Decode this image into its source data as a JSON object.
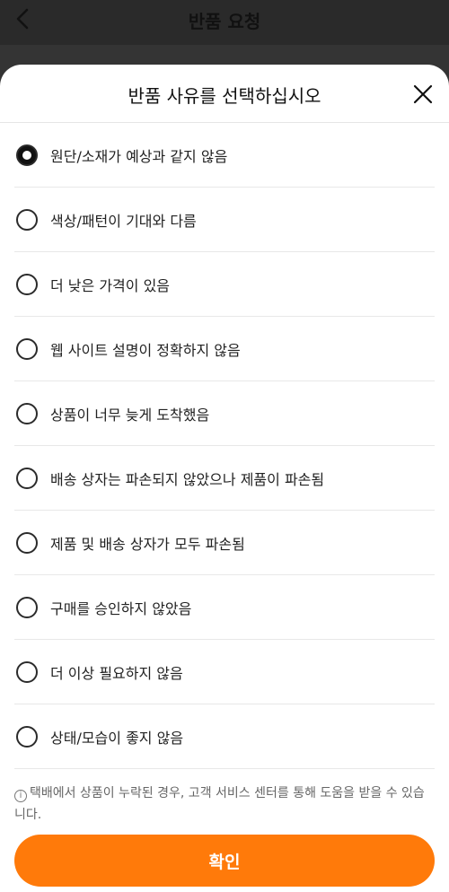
{
  "header": {
    "title": "반품 요청"
  },
  "sheet": {
    "title": "반품 사유를 선택하십시오",
    "options": [
      {
        "label": "원단/소재가 예상과 같지 않음",
        "selected": true
      },
      {
        "label": "색상/패턴이 기대와 다름",
        "selected": false
      },
      {
        "label": "더 낮은 가격이 있음",
        "selected": false
      },
      {
        "label": "웹 사이트 설명이 정확하지 않음",
        "selected": false
      },
      {
        "label": "상품이 너무 늦게 도착했음",
        "selected": false
      },
      {
        "label": "배송 상자는 파손되지 않았으나 제품이 파손됨",
        "selected": false
      },
      {
        "label": "제품 및 배송 상자가 모두 파손됨",
        "selected": false
      },
      {
        "label": "구매를 승인하지 않았음",
        "selected": false
      },
      {
        "label": "더 이상 필요하지 않음",
        "selected": false
      },
      {
        "label": "상태/모습이 좋지 않음",
        "selected": false
      }
    ],
    "notice": "택배에서 상품이 누락된 경우, 고객 서비스 센터를 통해 도움을 받을 수 있습니다.",
    "info_icon_glyph": "i",
    "confirm_label": "확인"
  },
  "colors": {
    "accent": "#ff7a0a",
    "overlay": "#2a2a2a"
  }
}
